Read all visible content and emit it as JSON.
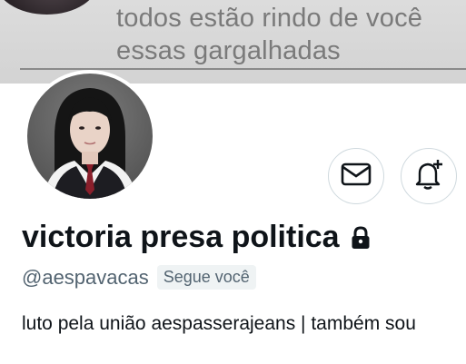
{
  "banner": {
    "line1": "todos estão rindo de você",
    "line2": "essas gargalhadas"
  },
  "profile": {
    "display_name": "victoria presa politica",
    "handle": "@aespavacas",
    "follows_you": "Segue você",
    "bio": "luto pela união aespasserajeans | também sou"
  },
  "icons": {
    "mail": "envelope-icon",
    "notify": "bell-plus-icon",
    "lock": "lock-icon"
  },
  "colors": {
    "text_primary": "#0f1419",
    "text_secondary": "#536471",
    "button_border": "#cfd9de",
    "badge_bg": "#eff3f4"
  }
}
